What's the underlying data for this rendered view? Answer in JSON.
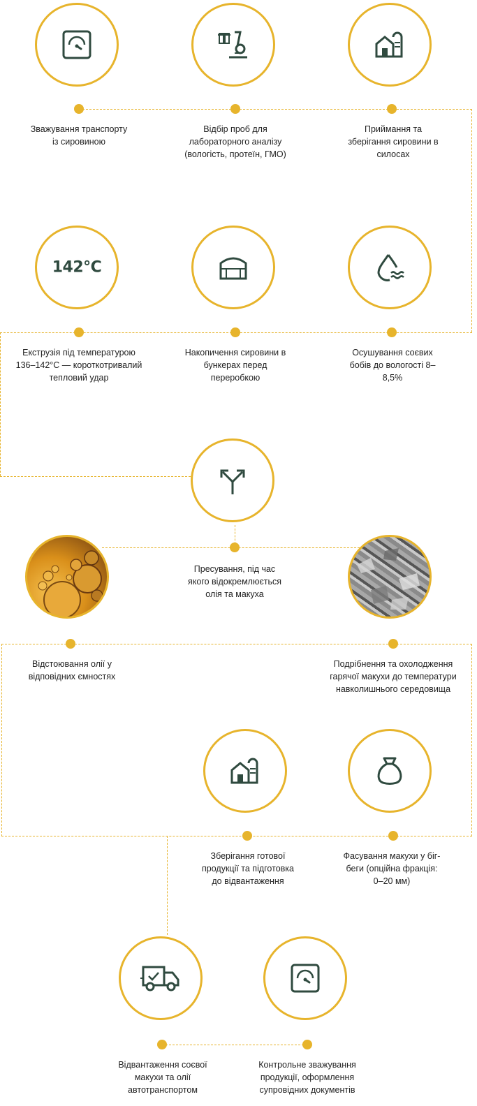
{
  "steps": [
    {
      "id": "s1",
      "label": "Зважування транспорту із сировиною",
      "icon": "scale-icon"
    },
    {
      "id": "s2",
      "label": "Відбір проб для лабораторного аналізу (вологість, протеїн, ГМО)",
      "icon": "microscope-icon"
    },
    {
      "id": "s3",
      "label": "Приймання та зберігання сировини в силосах",
      "icon": "silo-icon"
    },
    {
      "id": "s4",
      "label": "Осушування соєвих бобів до вологості 8–8,5%",
      "icon": "moisture-icon"
    },
    {
      "id": "s5",
      "label": "Накопичення сировини в бункерах перед переробкою",
      "icon": "bunker-icon"
    },
    {
      "id": "s6",
      "label": "Екструзія під температурою 136–142°С — короткотривалий тепловий удар",
      "icon_text": "142°С"
    },
    {
      "id": "s7",
      "label": "Пресування, під час якого відокремлюється олія та макуха",
      "icon": "split-arrow-icon"
    },
    {
      "id": "s8",
      "label": "Відстоювання олії у відповідних ємностях",
      "image": "oil-bubbles-photo"
    },
    {
      "id": "s9",
      "label": "Подрібнення та охолодження гарячої макухи до температури навколишнього середовища",
      "image": "crushed-cake-photo"
    },
    {
      "id": "s10",
      "label": "Фасування макухи у біг-беги (опційна фракція: 0–20 мм)",
      "icon": "bag-icon"
    },
    {
      "id": "s11",
      "label": "Зберігання готової продукції та підготовка до відвантаження",
      "icon": "silo-icon"
    },
    {
      "id": "s12",
      "label": "Відвантаження соєвої макухи та олії автотранспортом",
      "icon": "truck-icon"
    },
    {
      "id": "s13",
      "label": "Контрольне зважування продукції, оформлення супровідних документів",
      "icon": "scale-icon"
    }
  ],
  "colors": {
    "accent": "#e7b42c",
    "icon": "#2f4a3f"
  }
}
